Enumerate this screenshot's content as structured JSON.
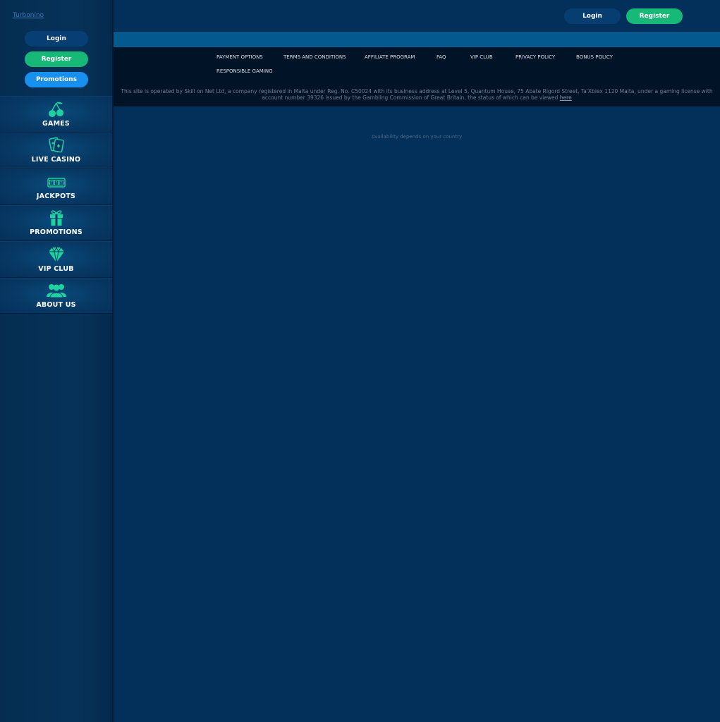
{
  "brand": {
    "logo_text": "Turbonino"
  },
  "sidebar": {
    "login_label": "Login",
    "register_label": "Register",
    "promotions_label": "Promotions",
    "nav": [
      {
        "label": "GAMES",
        "icon": "cherry-icon"
      },
      {
        "label": "LIVE CASINO",
        "icon": "playing-cards-icon"
      },
      {
        "label": "JACKPOTS",
        "icon": "slot-machine-icon"
      },
      {
        "label": "PROMOTIONS",
        "icon": "gift-icon"
      },
      {
        "label": "VIP CLUB",
        "icon": "diamond-icon"
      },
      {
        "label": "ABOUT US",
        "icon": "users-icon"
      }
    ]
  },
  "header": {
    "login_label": "Login",
    "register_label": "Register"
  },
  "footer": {
    "links": [
      "PAYMENT OPTIONS",
      "TERMS AND CONDITIONS",
      "AFFILIATE PROGRAM",
      "FAQ",
      "VIP CLUB",
      "PRIVACY POLICY",
      "BONUS POLICY",
      "RESPONSIBLE GAMING"
    ],
    "legal_text": "This site is operated by Skill on Net Ltd, a company registered in Malta under Reg. No. C50024 with its business address at Level 5, Quantum House, 75 Abate Rigord Street, Ta'Xbiex 1120 Malta, under a gaming license with account number 39326 issued by the Gambling Commission of Great Britain, the status of which can be viewed",
    "legal_link": "here"
  },
  "availability": "Availability depends on your country",
  "colors": {
    "accent_green": "#17b978",
    "accent_blue": "#1890f0",
    "background": "#02305a",
    "icon_teal": "#1fd3a0"
  }
}
